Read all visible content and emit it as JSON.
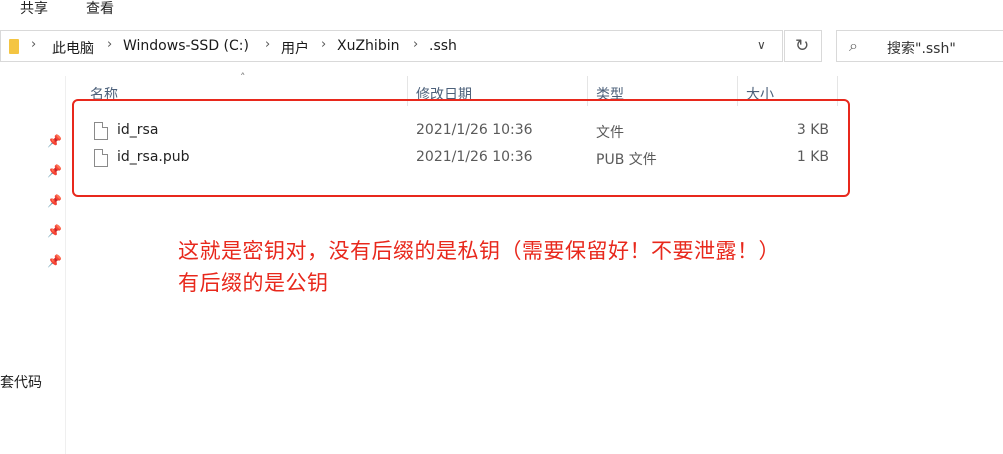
{
  "ribbon": {
    "tabs": [
      "共享",
      "查看"
    ]
  },
  "address": {
    "crumbs": [
      "此电脑",
      "Windows-SSD (C:)",
      "用户",
      "XuZhibin",
      ".ssh"
    ]
  },
  "search": {
    "placeholder": "搜索\".ssh\""
  },
  "sidebar": {
    "partial_text": "套代码"
  },
  "columns": [
    "名称",
    "修改日期",
    "类型",
    "大小"
  ],
  "files": [
    {
      "name": "id_rsa",
      "modified": "2021/1/26 10:36",
      "type": "文件",
      "size": "3 KB"
    },
    {
      "name": "id_rsa.pub",
      "modified": "2021/1/26 10:36",
      "type": "PUB 文件",
      "size": "1 KB"
    }
  ],
  "annotation": {
    "line1": "这就是密钥对，没有后缀的是私钥（需要保留好！不要泄露！）",
    "line2": "有后缀的是公钥",
    "color": "#e8281c"
  },
  "icons": {
    "folder": "folder-icon",
    "chevron": "chevron-right-icon",
    "dropdown": "chevron-down-icon",
    "refresh": "refresh-icon",
    "search": "search-icon",
    "pin": "pin-icon",
    "file": "file-icon"
  }
}
